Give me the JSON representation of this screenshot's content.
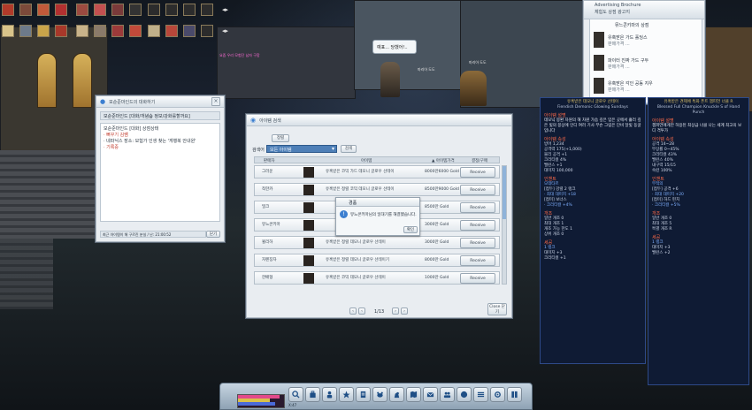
{
  "scene": {
    "npc_speech": "예표... 당했어!..",
    "chat_lines": [
      "요즘 우리 모험단 남자 구함",
      "뉴비 환영 모집중"
    ],
    "characters": [
      "마리아 도도",
      "마리아 도도"
    ]
  },
  "chat_window": {
    "title": "모순준마인드의 대화하기",
    "subtitle": "모순준마인드 [대화/개념숍 정보/강화를할까요]",
    "lines": [
      "모순준마인드 [대화] 상점상태",
      "· 뻐꾸기 김쌤",
      "· 네파닉스 장소: 모험가 인생 찾는 '게행복 안내원'",
      "· 기록중"
    ],
    "footer": "최근 아이템이 해 구르진 분실 / 난: 21:00:52",
    "button": "닫기"
  },
  "auction": {
    "title": "아이템 검색",
    "tab": "정렬",
    "search_label": "검색어",
    "search_value": "모든 아이템",
    "search_button": "검색",
    "columns": [
      "판매자",
      "",
      "아이템",
      "▲ 아이템가격",
      "결정/구매"
    ],
    "rows": [
      {
        "seller": "그러운",
        "item": "유혹받은 코믹 가드 데모니 글로우 선테이",
        "price": "8000만6000 Gold",
        "action": "Receive"
      },
      {
        "seller": "착한카",
        "item": "유혹받은 정렬 코믹 데모니 글로우 선테이",
        "price": "8500만9000 Gold",
        "action": "Receive"
      },
      {
        "seller": "밀크",
        "item": "",
        "price": "8500만 Gold",
        "action": "Receive"
      },
      {
        "seller": "뮤느콘키마",
        "item": "",
        "price": "3000만 Gold",
        "action": "Receive"
      },
      {
        "seller": "윌리하",
        "item": "유혹받은 정렬 데모니 글로우 선테이",
        "price": "3000만 Gold",
        "action": "Receive"
      },
      {
        "seller": "자펜징자",
        "item": "유혹받은 정렬 데모니 글로우 선테이기",
        "price": "8000만 Gold",
        "action": "Receive"
      },
      {
        "seller": "한배형",
        "item": "유혹받은 코믹 데모니 글로우 선테이",
        "price": "1000만 Gold",
        "action": "Receive"
      }
    ],
    "page": "1/13",
    "close_button": "Close 닫기",
    "dialog": {
      "title": "경품",
      "message": "뮤느콘키마님의 일대기를 해결했습니다.",
      "ok": "확인"
    }
  },
  "shop_panel": {
    "title": "Advertising Brochure",
    "subtitle": "체험도 상점 광고지",
    "list_header": "뮤느콘키마의 상점",
    "items": [
      {
        "name": "유혹받은 가드 홀딩스",
        "sub": "판매가격 ..."
      },
      {
        "name": "파이터 진짜 가드 구두",
        "sub": "판매가격 ..."
      },
      {
        "name": "유혹받은 각인 공동 지우",
        "sub": "판매가격 ..."
      }
    ]
  },
  "tooltip_left": {
    "title": "유혹받은 데모니 글로우 선테이",
    "subtitle": "Fiendish Demonic Glowing Sundays",
    "tag": "아이템 설명",
    "desc": "데모닉 몽환 차원의 해 차원 가슴 깊은 입은 곳에서 흘러 깊은 빛의 몽상에 인디 여러 기사 무슨 그림은 단비 달빛 동굴입니다",
    "sections": [
      {
        "hdr": "아이템 속성",
        "lines": [
          "방어 1,234",
          "공격력 175(+1,000)",
          "물리 공격 +1",
          "크리티컬 4%",
          "밸런스 +1",
          "대미지 100,000"
        ]
      },
      {
        "hdr": "인챈트",
        "lines": [
          "모데타르",
          "[접두] 강렬 2 랭크",
          "· 최대 대미지 +18",
          "[접미] 보너스",
          "· 크리티컬 +4%"
        ]
      },
      {
        "hdr": "개조",
        "lines": [
          "일반 개조 0",
          "최대 개조 1",
          "개조 가능 한도 1",
          "상위 개조 0"
        ]
      },
      {
        "hdr": "세공",
        "lines": [
          "1 랭크",
          "대미지 +3",
          "크리티컬 +1"
        ]
      }
    ]
  },
  "tooltip_right": {
    "title": "유혹받은 견제에 특화 폰트 챔피언 너클 R",
    "subtitle": "Blessed Full Champion Knuckle S of Hand Punch",
    "tag": "아이템 설명",
    "desc": "챔피언에게만 허용된 최상급 너클 나는 세계 최고의 보디 격투가",
    "sections": [
      {
        "hdr": "아이템 속성",
        "lines": [
          "공격 14~28",
          "부상률 0~45%",
          "크리티컬 43%",
          "밸런스 40%",
          "내구력 15/15",
          "숙련 100%"
        ]
      },
      {
        "hdr": "인챈트",
        "lines": [
          "무적의",
          "[접두] 공격 +6",
          "· 최대 대미지 +20",
          "[접미] 하드 펀치",
          "· 크리티컬 +5%"
        ]
      },
      {
        "hdr": "개조",
        "lines": [
          "일반 개조 0",
          "최대 개조 5",
          "특별 개조 R"
        ]
      },
      {
        "hdr": "세공",
        "lines": [
          "1 랭크",
          "대미지 +3",
          "밸런스 +2"
        ]
      }
    ]
  },
  "bottom_bar": {
    "icons": [
      "search-icon",
      "bag-icon",
      "character-icon",
      "skill-icon",
      "quest-icon",
      "pet-icon",
      "horse-icon",
      "map-icon",
      "mail-icon",
      "social-icon",
      "party-icon",
      "menu-icon",
      "options-icon",
      "journal-icon"
    ],
    "coords": "X:47"
  },
  "colors": {
    "panel_bg": "#e9edf1",
    "tooltip_bg": "#0f1b34",
    "accent": "#3c7fd0"
  }
}
